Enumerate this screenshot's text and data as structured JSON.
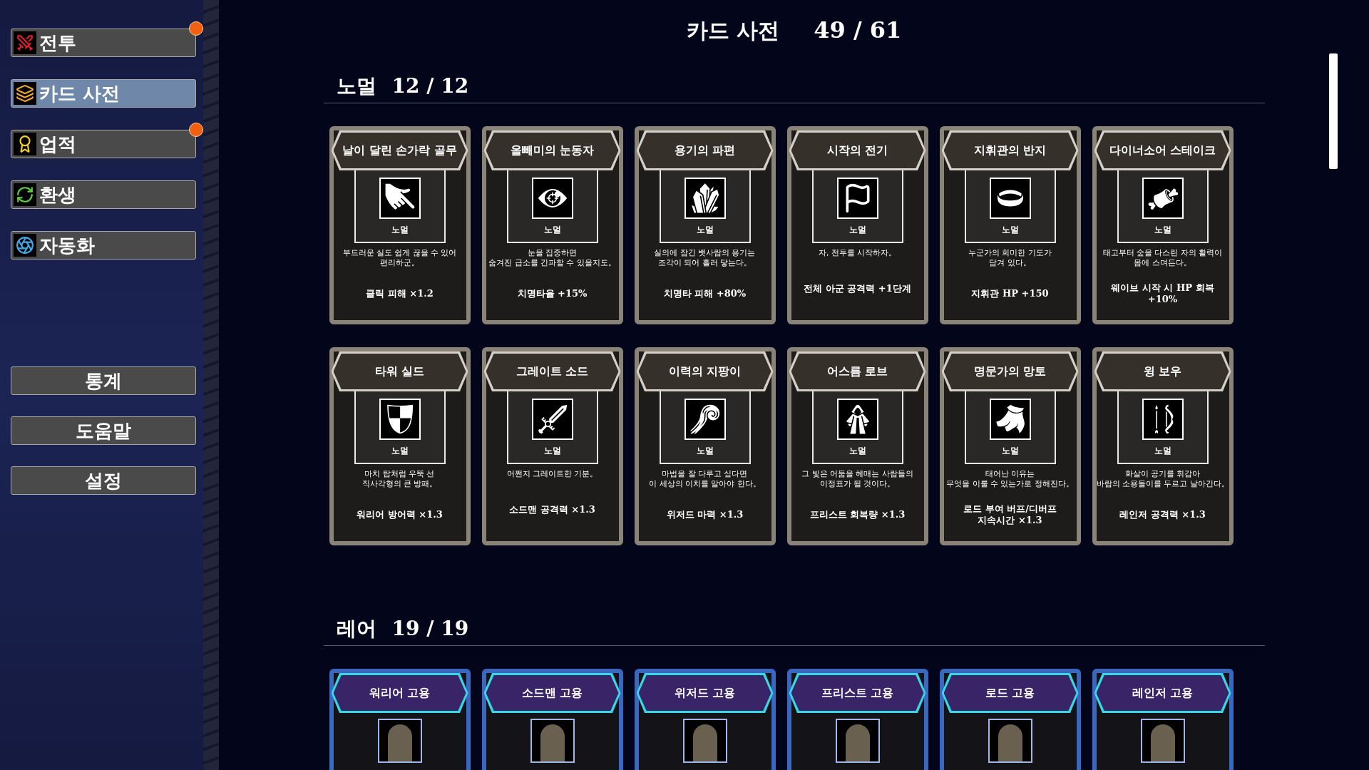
{
  "header": {
    "title": "카드 사전",
    "count": "49 / 61"
  },
  "sidebar": {
    "nav_items": [
      {
        "label": "전투",
        "selected": false,
        "notification": true
      },
      {
        "label": "카드 사전",
        "selected": true,
        "notification": false
      },
      {
        "label": "업적",
        "selected": false,
        "notification": true
      },
      {
        "label": "환생",
        "selected": false,
        "notification": false
      },
      {
        "label": "자동화",
        "selected": false,
        "notification": false
      }
    ],
    "buttons": [
      "통계",
      "도움말",
      "설정"
    ]
  },
  "sections": [
    {
      "name": "노멀",
      "count": "12 / 12",
      "kind": "normal",
      "cards": [
        {
          "title": "날이 달린 손가락 골무",
          "rarity": "노멀",
          "description": "부드러운 실도 쉽게 끊을 수 있어\n편리하군。",
          "effect": "클릭 피해 ×1.2"
        },
        {
          "title": "올빼미의 눈동자",
          "rarity": "노멀",
          "description": "눈을 집중하면\n숨겨진 급소를 간파할 수 있을지도。",
          "effect": "치명타율 +15%"
        },
        {
          "title": "용기의 파편",
          "rarity": "노멀",
          "description": "실의에 잠긴 뱃사람의 용기는\n조각이 되어 흘러 닿는다。",
          "effect": "치명타 피해 +80%"
        },
        {
          "title": "시작의 전기",
          "rarity": "노멀",
          "description": "자, 전투를 시작하자。",
          "effect": "전체 아군 공격력 +1단계"
        },
        {
          "title": "지휘관의 반지",
          "rarity": "노멀",
          "description": "누군가의 희미한 기도가\n담겨 있다。",
          "effect": "지휘관 HP +150"
        },
        {
          "title": "다이너소어 스테이크",
          "rarity": "노멀",
          "description": "태고부터 숲을 다스린 자의 활력이\n몸에 스며든다。",
          "effect": "웨이브 시작 시 HP 회복 +10%"
        },
        {
          "title": "타워 실드",
          "rarity": "노멀",
          "description": "마치 탑처럼 우뚝 선\n직사각형의 큰 방패。",
          "effect": "워리어 방어력 ×1.3"
        },
        {
          "title": "그레이트 소드",
          "rarity": "노멀",
          "description": "어쩐지 그레이트한 기분。",
          "effect": "소드맨 공격력 ×1.3"
        },
        {
          "title": "이력의 지팡이",
          "rarity": "노멀",
          "description": "마법을 잘 다루고 싶다면\n이 세상의 이치를 알아야 한다。",
          "effect": "위저드 마력 ×1.3"
        },
        {
          "title": "어스름 로브",
          "rarity": "노멀",
          "description": "그 빛은 어둠을 헤매는 사람들의\n이정표가 될 것이다。",
          "effect": "프리스트 회복량 ×1.3"
        },
        {
          "title": "명문가의 망토",
          "rarity": "노멀",
          "description": "태어난 이유는\n무엇을 이룰 수 있는가로 정해진다。",
          "effect": "로드 부여 버프/디버프\n지속시간 ×1.3"
        },
        {
          "title": "윙 보우",
          "rarity": "노멀",
          "description": "화살이 공기를 휘감아\n바람의 소용돌이를 두르고 날아간다。",
          "effect": "레인저 공격력 ×1.3"
        }
      ]
    },
    {
      "name": "레어",
      "count": "19 / 19",
      "kind": "rare",
      "cards": [
        {
          "title": "워리어 고용"
        },
        {
          "title": "소드맨 고용"
        },
        {
          "title": "위저드 고용"
        },
        {
          "title": "프리스트 고용"
        },
        {
          "title": "로드 고용"
        },
        {
          "title": "레인저 고용"
        }
      ]
    }
  ]
}
